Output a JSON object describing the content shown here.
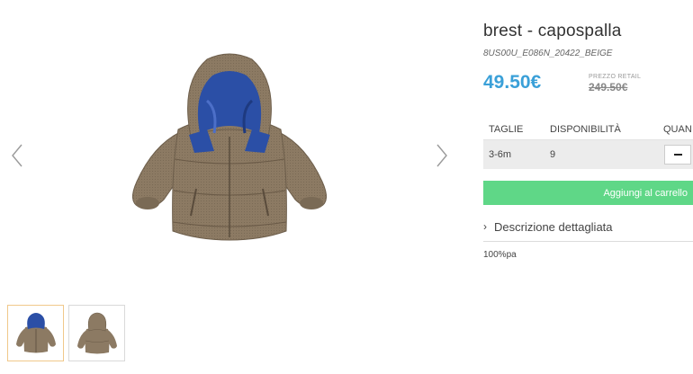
{
  "product": {
    "title": "brest - capospalla",
    "sku": "8US00U_E086N_20422_BEIGE",
    "price": "49.50€",
    "retail_label": "PREZZO RETAIL",
    "retail_price": "249.50€"
  },
  "sizes_table": {
    "headers": {
      "size": "TAGLIE",
      "availability": "DISPONIBILITÀ",
      "quantity": "QUAN"
    },
    "rows": [
      {
        "size": "3-6m",
        "availability": "9"
      }
    ]
  },
  "add_to_cart_label": "Aggiungi al carrello",
  "description": {
    "toggle_label": "Descrizione dettagliata",
    "text": "100%pa"
  },
  "gallery": {
    "thumbnails": [
      "jacket-with-hood-front",
      "jacket-back"
    ],
    "active_thumbnail": 0
  },
  "colors": {
    "price": "#3aa0d8",
    "add_button": "#5fd787",
    "jacket_body": "#8c7a63",
    "hood_lining": "#2b4fa6",
    "thumb_active_border": "#f0c88a"
  }
}
